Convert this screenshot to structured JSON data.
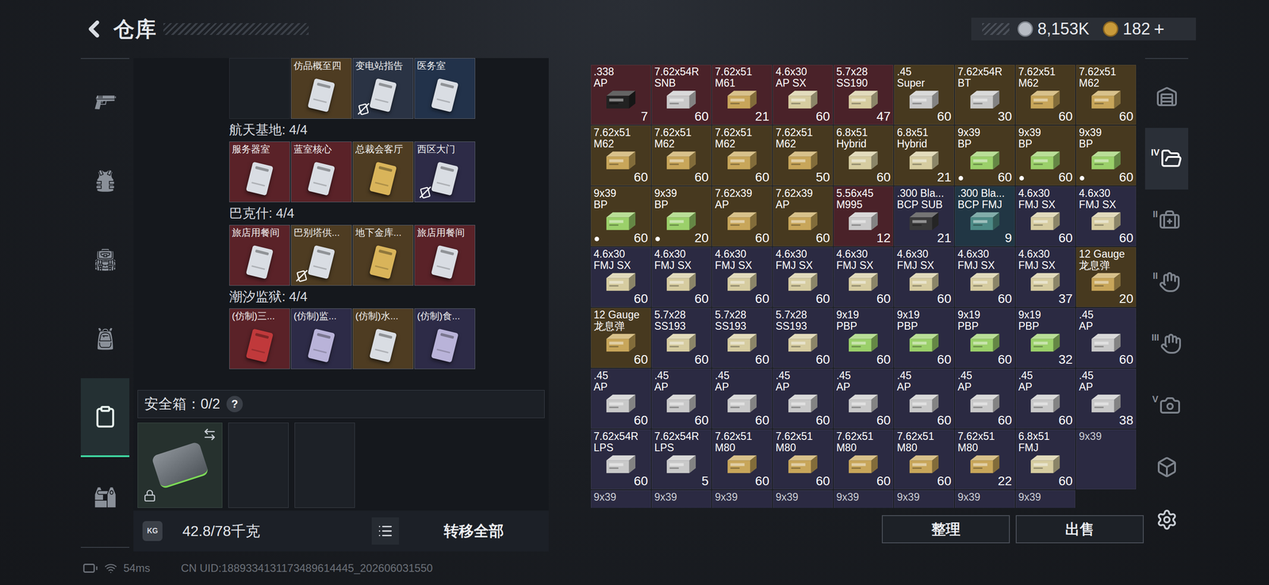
{
  "title": "仓库",
  "currency": {
    "coins": "8,153K",
    "tickets": "182",
    "add": "+"
  },
  "nav": [
    {
      "selected": false
    },
    {
      "selected": false
    },
    {
      "selected": false
    },
    {
      "selected": false
    },
    {
      "selected": true
    },
    {
      "selected": false
    }
  ],
  "scrolled_cards": [
    {
      "name": "",
      "kind": "empty",
      "color": "#1b1f25",
      "card_color": "#1b1f25",
      "restricted": false
    },
    {
      "name": "仿品概至四",
      "kind": "card",
      "color": "#4e3c22",
      "card_color": "#d9dde3",
      "restricted": false
    },
    {
      "name": "变电站指告",
      "kind": "card",
      "color": "#2a3344",
      "card_color": "#d9dde3",
      "restricted": true
    },
    {
      "name": "医务室",
      "kind": "card",
      "color": "#22324a",
      "card_color": "#d9dde3",
      "restricted": false
    }
  ],
  "key_sections": [
    {
      "title": "航天基地: 4/4",
      "cards": [
        {
          "name": "服务器室",
          "kind": "card",
          "color": "#5a2228",
          "card_color": "#d9dde3",
          "restricted": false
        },
        {
          "name": "蓝室核心",
          "kind": "card",
          "color": "#5a2228",
          "card_color": "#d9dde3",
          "restricted": false
        },
        {
          "name": "总裁会客厅",
          "kind": "card",
          "color": "#4e3c22",
          "card_color": "#d9b45a",
          "restricted": false
        },
        {
          "name": "西区大门",
          "kind": "card",
          "color": "#2d2b47",
          "card_color": "#d9dde3",
          "restricted": true
        }
      ]
    },
    {
      "title": "巴克什: 4/4",
      "cards": [
        {
          "name": "旅店用餐间",
          "kind": "card",
          "color": "#5a2228",
          "card_color": "#d9dde3",
          "restricted": false
        },
        {
          "name": "巴别塔供...",
          "kind": "card",
          "color": "#4e3c22",
          "card_color": "#d9dde3",
          "restricted": true
        },
        {
          "name": "地下金库...",
          "kind": "card",
          "color": "#4e3c22",
          "card_color": "#d9b45a",
          "restricted": false
        },
        {
          "name": "旅店用餐间",
          "kind": "card",
          "color": "#5a2228",
          "card_color": "#d9dde3",
          "restricted": false
        }
      ]
    },
    {
      "title": "潮汐监狱: 4/4",
      "cards": [
        {
          "name": "(仿制)三...",
          "kind": "card",
          "color": "#5a2228",
          "card_color": "#c0393b",
          "restricted": false
        },
        {
          "name": "(仿制)监...",
          "kind": "card",
          "color": "#2d2b47",
          "card_color": "#b9b3d9",
          "restricted": false
        },
        {
          "name": "(仿制)水...",
          "kind": "card",
          "color": "#4e3c22",
          "card_color": "#d9dde3",
          "restricted": false
        },
        {
          "name": "(仿制)食...",
          "kind": "card",
          "color": "#2d2b47",
          "card_color": "#b9b3d9",
          "restricted": false
        }
      ]
    }
  ],
  "safe_box": {
    "label": "安全箱：0/2",
    "help": "?",
    "slots": [
      {
        "kind": "case",
        "locked": true
      },
      {
        "kind": "empty",
        "locked": false
      },
      {
        "kind": "empty",
        "locked": false
      }
    ]
  },
  "weight": {
    "unit_icon": "KG",
    "value": "42.8/78千克"
  },
  "transfer_all": "转移全部",
  "ammo": [
    {
      "caliber": ".338",
      "type": "AP",
      "count": "7",
      "color": "#4a2229",
      "box": "#222222",
      "marked": false
    },
    {
      "caliber": "7.62x54R",
      "type": "SNB",
      "count": "60",
      "color": "#4a2229",
      "box": "#c9c9c9",
      "marked": false
    },
    {
      "caliber": "7.62x51",
      "type": "M61",
      "count": "21",
      "color": "#4a2229",
      "box": "#c8a65a",
      "marked": false
    },
    {
      "caliber": "4.6x30",
      "type": "AP SX",
      "count": "60",
      "color": "#4a2229",
      "box": "#d6cca0",
      "marked": false
    },
    {
      "caliber": "5.7x28",
      "type": "SS190",
      "count": "47",
      "color": "#4a2229",
      "box": "#d6cca0",
      "marked": false
    },
    {
      "caliber": ".45",
      "type": "Super",
      "count": "60",
      "color": "#47391f",
      "box": "#c9c9c9",
      "marked": false
    },
    {
      "caliber": "7.62x54R",
      "type": "BT",
      "count": "30",
      "color": "#47391f",
      "box": "#c9c9c9",
      "marked": false
    },
    {
      "caliber": "7.62x51",
      "type": "M62",
      "count": "60",
      "color": "#47391f",
      "box": "#c8a65a",
      "marked": false
    },
    {
      "caliber": "7.62x51",
      "type": "M62",
      "count": "60",
      "color": "#47391f",
      "box": "#c8a65a",
      "marked": false
    },
    {
      "caliber": "7.62x51",
      "type": "M62",
      "count": "60",
      "color": "#47391f",
      "box": "#c8a65a",
      "marked": false
    },
    {
      "caliber": "7.62x51",
      "type": "M62",
      "count": "60",
      "color": "#47391f",
      "box": "#c8a65a",
      "marked": false
    },
    {
      "caliber": "7.62x51",
      "type": "M62",
      "count": "60",
      "color": "#47391f",
      "box": "#c8a65a",
      "marked": false
    },
    {
      "caliber": "7.62x51",
      "type": "M62",
      "count": "50",
      "color": "#47391f",
      "box": "#c8a65a",
      "marked": false
    },
    {
      "caliber": "6.8x51",
      "type": "Hybrid",
      "count": "60",
      "color": "#47391f",
      "box": "#d6cca0",
      "marked": false
    },
    {
      "caliber": "6.8x51",
      "type": "Hybrid",
      "count": "21",
      "color": "#47391f",
      "box": "#d6cca0",
      "marked": false
    },
    {
      "caliber": "9x39",
      "type": "BP",
      "count": "60",
      "color": "#47391f",
      "box": "#9bd06a",
      "marked": true
    },
    {
      "caliber": "9x39",
      "type": "BP",
      "count": "60",
      "color": "#47391f",
      "box": "#9bd06a",
      "marked": true
    },
    {
      "caliber": "9x39",
      "type": "BP",
      "count": "60",
      "color": "#47391f",
      "box": "#9bd06a",
      "marked": true
    },
    {
      "caliber": "9x39",
      "type": "BP",
      "count": "60",
      "color": "#47391f",
      "box": "#9bd06a",
      "marked": true
    },
    {
      "caliber": "9x39",
      "type": "BP",
      "count": "20",
      "color": "#47391f",
      "box": "#9bd06a",
      "marked": true
    },
    {
      "caliber": "7.62x39",
      "type": "AP",
      "count": "60",
      "color": "#47391f",
      "box": "#c8a65a",
      "marked": false
    },
    {
      "caliber": "7.62x39",
      "type": "AP",
      "count": "60",
      "color": "#47391f",
      "box": "#c8a65a",
      "marked": false
    },
    {
      "caliber": "5.56x45",
      "type": "M995",
      "count": "12",
      "color": "#4a2229",
      "box": "#c9c9c9",
      "marked": false
    },
    {
      "caliber": ".300 Bla...",
      "type": "BCP SUB",
      "count": "21",
      "color": "#2b2a42",
      "box": "#3a3a3a",
      "marked": false
    },
    {
      "caliber": ".300 Bla...",
      "type": "BCP FMJ",
      "count": "9",
      "color": "#213644",
      "box": "#4d8a86",
      "marked": false
    },
    {
      "caliber": "4.6x30",
      "type": "FMJ SX",
      "count": "60",
      "color": "#2b2a42",
      "box": "#d6cca0",
      "marked": false
    },
    {
      "caliber": "4.6x30",
      "type": "FMJ SX",
      "count": "60",
      "color": "#2b2a42",
      "box": "#d6cca0",
      "marked": false
    },
    {
      "caliber": "4.6x30",
      "type": "FMJ SX",
      "count": "60",
      "color": "#2b2a42",
      "box": "#d6cca0",
      "marked": false
    },
    {
      "caliber": "4.6x30",
      "type": "FMJ SX",
      "count": "60",
      "color": "#2b2a42",
      "box": "#d6cca0",
      "marked": false
    },
    {
      "caliber": "4.6x30",
      "type": "FMJ SX",
      "count": "60",
      "color": "#2b2a42",
      "box": "#d6cca0",
      "marked": false
    },
    {
      "caliber": "4.6x30",
      "type": "FMJ SX",
      "count": "60",
      "color": "#2b2a42",
      "box": "#d6cca0",
      "marked": false
    },
    {
      "caliber": "4.6x30",
      "type": "FMJ SX",
      "count": "60",
      "color": "#2b2a42",
      "box": "#d6cca0",
      "marked": false
    },
    {
      "caliber": "4.6x30",
      "type": "FMJ SX",
      "count": "60",
      "color": "#2b2a42",
      "box": "#d6cca0",
      "marked": false
    },
    {
      "caliber": "4.6x30",
      "type": "FMJ SX",
      "count": "60",
      "color": "#2b2a42",
      "box": "#d6cca0",
      "marked": false
    },
    {
      "caliber": "4.6x30",
      "type": "FMJ SX",
      "count": "37",
      "color": "#2b2a42",
      "box": "#d6cca0",
      "marked": false
    },
    {
      "caliber": "12 Gauge",
      "type": "龙息弹",
      "count": "20",
      "color": "#47391f",
      "box": "#c8a65a",
      "marked": false
    },
    {
      "caliber": "12 Gauge",
      "type": "龙息弹",
      "count": "60",
      "color": "#47391f",
      "box": "#c8a65a",
      "marked": false
    },
    {
      "caliber": "5.7x28",
      "type": "SS193",
      "count": "60",
      "color": "#2b2a42",
      "box": "#d6cca0",
      "marked": false
    },
    {
      "caliber": "5.7x28",
      "type": "SS193",
      "count": "60",
      "color": "#2b2a42",
      "box": "#d6cca0",
      "marked": false
    },
    {
      "caliber": "5.7x28",
      "type": "SS193",
      "count": "60",
      "color": "#2b2a42",
      "box": "#d6cca0",
      "marked": false
    },
    {
      "caliber": "9x19",
      "type": "PBP",
      "count": "60",
      "color": "#2b2a42",
      "box": "#9bd06a",
      "marked": false
    },
    {
      "caliber": "9x19",
      "type": "PBP",
      "count": "60",
      "color": "#2b2a42",
      "box": "#9bd06a",
      "marked": false
    },
    {
      "caliber": "9x19",
      "type": "PBP",
      "count": "60",
      "color": "#2b2a42",
      "box": "#9bd06a",
      "marked": false
    },
    {
      "caliber": "9x19",
      "type": "PBP",
      "count": "32",
      "color": "#2b2a42",
      "box": "#9bd06a",
      "marked": false
    },
    {
      "caliber": ".45",
      "type": "AP",
      "count": "60",
      "color": "#2b2a42",
      "box": "#c9c9c9",
      "marked": false
    },
    {
      "caliber": ".45",
      "type": "AP",
      "count": "60",
      "color": "#2b2a42",
      "box": "#c9c9c9",
      "marked": false
    },
    {
      "caliber": ".45",
      "type": "AP",
      "count": "60",
      "color": "#2b2a42",
      "box": "#c9c9c9",
      "marked": false
    },
    {
      "caliber": ".45",
      "type": "AP",
      "count": "60",
      "color": "#2b2a42",
      "box": "#c9c9c9",
      "marked": false
    },
    {
      "caliber": ".45",
      "type": "AP",
      "count": "60",
      "color": "#2b2a42",
      "box": "#c9c9c9",
      "marked": false
    },
    {
      "caliber": ".45",
      "type": "AP",
      "count": "60",
      "color": "#2b2a42",
      "box": "#c9c9c9",
      "marked": false
    },
    {
      "caliber": ".45",
      "type": "AP",
      "count": "60",
      "color": "#2b2a42",
      "box": "#c9c9c9",
      "marked": false
    },
    {
      "caliber": ".45",
      "type": "AP",
      "count": "60",
      "color": "#2b2a42",
      "box": "#c9c9c9",
      "marked": false
    },
    {
      "caliber": ".45",
      "type": "AP",
      "count": "60",
      "color": "#2b2a42",
      "box": "#c9c9c9",
      "marked": false
    },
    {
      "caliber": ".45",
      "type": "AP",
      "count": "38",
      "color": "#2b2a42",
      "box": "#c9c9c9",
      "marked": false
    },
    {
      "caliber": "7.62x54R",
      "type": "LPS",
      "count": "60",
      "color": "#2b2a42",
      "box": "#c9c9c9",
      "marked": false
    },
    {
      "caliber": "7.62x54R",
      "type": "LPS",
      "count": "5",
      "color": "#2b2a42",
      "box": "#c9c9c9",
      "marked": false
    },
    {
      "caliber": "7.62x51",
      "type": "M80",
      "count": "60",
      "color": "#2b2a42",
      "box": "#c8a65a",
      "marked": false
    },
    {
      "caliber": "7.62x51",
      "type": "M80",
      "count": "60",
      "color": "#2b2a42",
      "box": "#c8a65a",
      "marked": false
    },
    {
      "caliber": "7.62x51",
      "type": "M80",
      "count": "60",
      "color": "#2b2a42",
      "box": "#c8a65a",
      "marked": false
    },
    {
      "caliber": "7.62x51",
      "type": "M80",
      "count": "60",
      "color": "#2b2a42",
      "box": "#c8a65a",
      "marked": false
    },
    {
      "caliber": "7.62x51",
      "type": "M80",
      "count": "22",
      "color": "#2b2a42",
      "box": "#c8a65a",
      "marked": false
    },
    {
      "caliber": "6.8x51",
      "type": "FMJ",
      "count": "60",
      "color": "#2b2a42",
      "box": "#d6cca0",
      "marked": false
    }
  ],
  "ammo_partial_row": [
    {
      "caliber": "9x39",
      "color": "#2b2a42"
    },
    {
      "caliber": "9x39",
      "color": "#2b2a42"
    },
    {
      "caliber": "9x39",
      "color": "#2b2a42"
    },
    {
      "caliber": "9x39",
      "color": "#2b2a42"
    },
    {
      "caliber": "9x39",
      "color": "#2b2a42"
    },
    {
      "caliber": "9x39",
      "color": "#2b2a42"
    },
    {
      "caliber": "9x39",
      "color": "#2b2a42"
    },
    {
      "caliber": "9x39",
      "color": "#2b2a42"
    },
    {
      "caliber": "9x39",
      "color": "#2b2a42"
    }
  ],
  "buttons": [
    "整理",
    "出售"
  ],
  "right_tabs": [
    {
      "badge": "",
      "selected": false
    },
    {
      "badge": "IV",
      "selected": true
    },
    {
      "badge": "II",
      "selected": false
    },
    {
      "badge": "II",
      "selected": false
    },
    {
      "badge": "III",
      "selected": false
    },
    {
      "badge": "V",
      "selected": false
    },
    {
      "badge": "",
      "selected": false
    }
  ],
  "status": {
    "ping": "54ms",
    "uid": "CN UID:1889334131173489614445_202606031550"
  }
}
